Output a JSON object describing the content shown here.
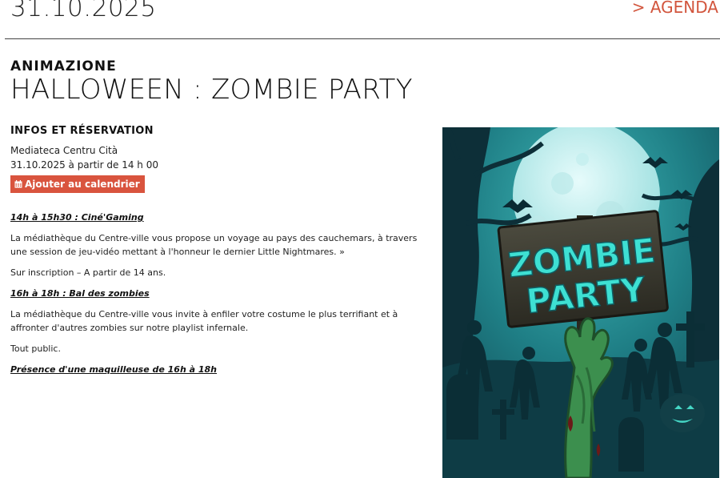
{
  "header": {
    "date": "31.10.2025",
    "agenda_link": "> AGENDA"
  },
  "event": {
    "category": "ANIMAZIONE",
    "title": "HALLOWEEN : ZOMBIE PARTY"
  },
  "infos": {
    "heading": "INFOS ET RÉSERVATION",
    "place": "Mediateca Centru Cità",
    "when": "31.10.2025 à partir de 14 h 00",
    "calendar_button": "Ajouter au calendrier",
    "calendar_icon": "calendar-icon"
  },
  "program": {
    "session1_title": "14h à 15h30 : Ciné'Gaming",
    "session1_text": "La médiathèque du Centre-ville vous propose un voyage au pays des cauchemars, à travers une session de jeu-vidéo mettant à l'honneur le dernier Little Nightmares. »",
    "session1_note": "Sur inscription – A partir de 14 ans.",
    "session2_title": "16h à 18h : Bal des zombies",
    "session2_text": "La médiathèque du Centre-ville vous invite à enfiler votre costume le plus terrifiant et à affronter d'autres zombies sur notre playlist infernale.",
    "session2_note": "Tout public.",
    "extra": "Présence d'une maquilleuse de 16h à 18h"
  },
  "poster": {
    "sign_line1": "ZOMBIE",
    "sign_line2": "PARTY"
  },
  "colors": {
    "accent": "#d9543e",
    "poster_sky": "#1f7f86",
    "poster_moon": "#cfeff0",
    "poster_sign_text": "#3ee0d3"
  }
}
